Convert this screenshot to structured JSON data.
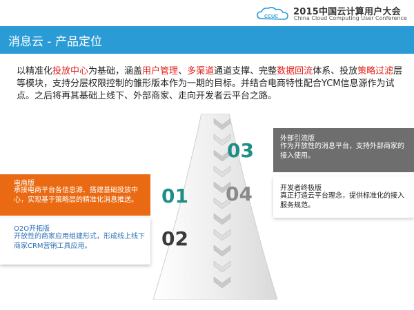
{
  "header": {
    "conference_cn": "2015中国云计算用户大会",
    "conference_en": "China Cloud Computing User Conference",
    "logo_text": "CCUC"
  },
  "title": "消息云 - 产品定位",
  "intro": [
    {
      "text": "以精准化",
      "hl": false
    },
    {
      "text": "投放中心",
      "hl": true
    },
    {
      "text": "为基础，涵盖",
      "hl": false
    },
    {
      "text": "用户管理",
      "hl": true
    },
    {
      "text": "、",
      "hl": false
    },
    {
      "text": "多渠道",
      "hl": true
    },
    {
      "text": "通道支撑、完整",
      "hl": false
    },
    {
      "text": "数据回流",
      "hl": true
    },
    {
      "text": "体系、投放",
      "hl": false
    },
    {
      "text": "策略过滤",
      "hl": true
    },
    {
      "text": "层等模块，支持分层权限控制的雏形版本作为一期的目标。并结合电商特性配合YCM信息源作为试点。之后将再其基础上线下、外部商家、走向开发者云平台之路。",
      "hl": false
    }
  ],
  "stages": {
    "s01": {
      "num": "01",
      "title": "电商版",
      "desc": "承接电商平台各信息源、搭建基础投放中心，实现基于策略层的精准化消息推送。"
    },
    "s02": {
      "num": "02",
      "title": "O2O开拓版",
      "desc": "开放性的商家应用组建形式，形成线上线下商家CRM营销工具应用。"
    },
    "s03": {
      "num": "03",
      "title": "外部引流版",
      "desc": "作为开放性的消息平台，支持外部商家的接入使用。"
    },
    "s04": {
      "num": "04",
      "title": "开发者终极版",
      "desc": "真正打造云平台理念，提供标准化的接入服务规范。"
    }
  },
  "colors": {
    "title_bar": "#2b9bd6",
    "highlight": "#e0211b",
    "orange": "#ea6a13",
    "gray": "#6e6e6e",
    "teal": "#1e8e86",
    "dark": "#3a3a3a",
    "light_gray_num": "#8a8a8a"
  },
  "icons": [
    "ccuc-logo-icon",
    "chevron-down-icon"
  ]
}
